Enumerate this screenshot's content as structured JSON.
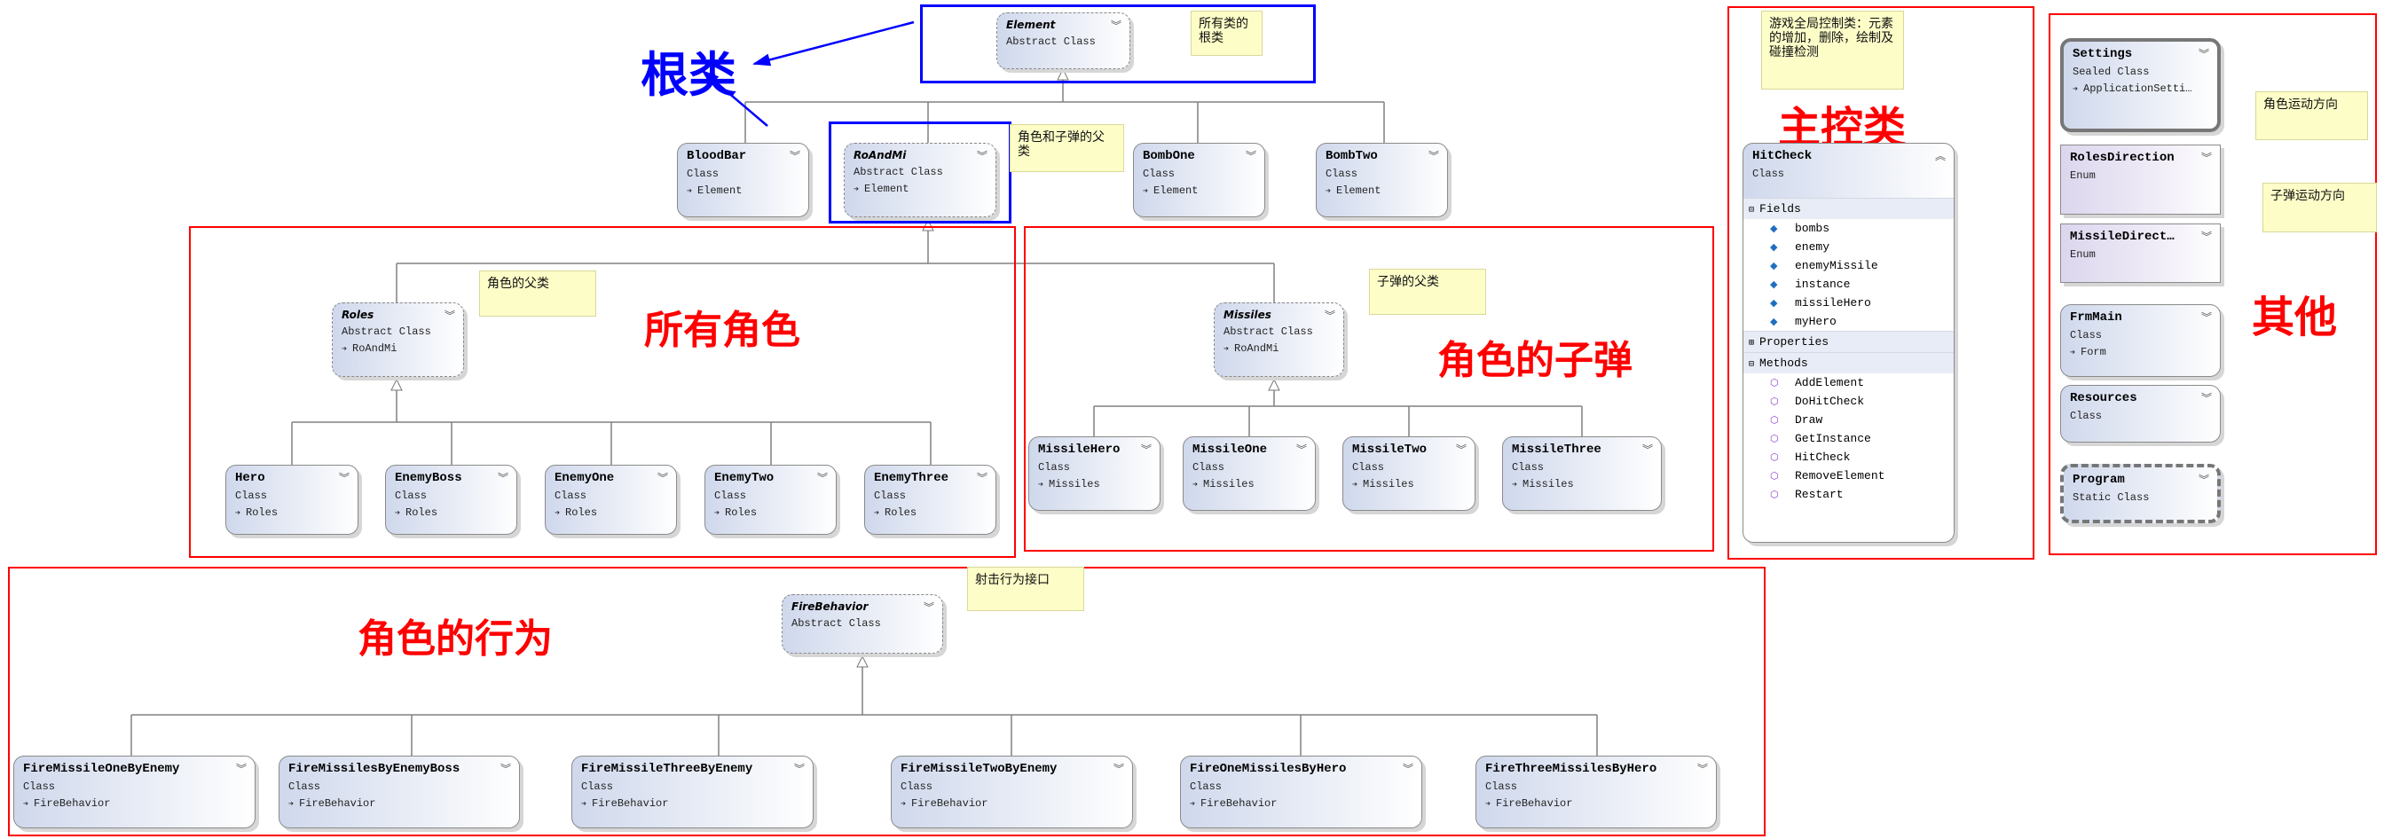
{
  "labels": {
    "root": "根类",
    "all_roles": "所有角色",
    "role_missiles": "角色的子弹",
    "role_behavior": "角色的行为",
    "main_control": "主控类",
    "others": "其他"
  },
  "colors": {
    "group_border": "#ff0000",
    "root_border": "#0000ff",
    "note_bg": "#fdfdc8"
  },
  "notes": [
    "所有类的根类",
    "角色和子弹的父类",
    "角色的父类",
    "子弹的父类",
    "射击行为接口",
    "游戏全局控制类：元素的增加，删除，绘制及碰撞检测",
    "角色运动方向",
    "子弹运动方向"
  ],
  "classes": [
    {
      "name": "Element",
      "kind": "Abstract Class",
      "base": "",
      "style": "abstract"
    },
    {
      "name": "BloodBar",
      "kind": "Class",
      "base": "Element",
      "style": ""
    },
    {
      "name": "RoAndMi",
      "kind": "Abstract Class",
      "base": "Element",
      "style": "abstract"
    },
    {
      "name": "BombOne",
      "kind": "Class",
      "base": "Element",
      "style": ""
    },
    {
      "name": "BombTwo",
      "kind": "Class",
      "base": "Element",
      "style": ""
    },
    {
      "name": "Roles",
      "kind": "Abstract Class",
      "base": "RoAndMi",
      "style": "abstract"
    },
    {
      "name": "Hero",
      "kind": "Class",
      "base": "Roles",
      "style": ""
    },
    {
      "name": "EnemyBoss",
      "kind": "Class",
      "base": "Roles",
      "style": ""
    },
    {
      "name": "EnemyOne",
      "kind": "Class",
      "base": "Roles",
      "style": ""
    },
    {
      "name": "EnemyTwo",
      "kind": "Class",
      "base": "Roles",
      "style": ""
    },
    {
      "name": "EnemyThree",
      "kind": "Class",
      "base": "Roles",
      "style": ""
    },
    {
      "name": "Missiles",
      "kind": "Abstract Class",
      "base": "RoAndMi",
      "style": "abstract"
    },
    {
      "name": "MissileHero",
      "kind": "Class",
      "base": "Missiles",
      "style": ""
    },
    {
      "name": "MissileOne",
      "kind": "Class",
      "base": "Missiles",
      "style": ""
    },
    {
      "name": "MissileTwo",
      "kind": "Class",
      "base": "Missiles",
      "style": ""
    },
    {
      "name": "MissileThree",
      "kind": "Class",
      "base": "Missiles",
      "style": ""
    },
    {
      "name": "FireBehavior",
      "kind": "Abstract Class",
      "base": "",
      "style": "abstract"
    },
    {
      "name": "FireMissileOneByEnemy",
      "kind": "Class",
      "base": "FireBehavior",
      "style": ""
    },
    {
      "name": "FireMissilesByEnemyBoss",
      "kind": "Class",
      "base": "FireBehavior",
      "style": ""
    },
    {
      "name": "FireMissileThreeByEnemy",
      "kind": "Class",
      "base": "FireBehavior",
      "style": ""
    },
    {
      "name": "FireMissileTwoByEnemy",
      "kind": "Class",
      "base": "FireBehavior",
      "style": ""
    },
    {
      "name": "FireOneMissilesByHero",
      "kind": "Class",
      "base": "FireBehavior",
      "style": ""
    },
    {
      "name": "FireThreeMissilesByHero",
      "kind": "Class",
      "base": "FireBehavior",
      "style": ""
    },
    {
      "name": "Settings",
      "kind": "Sealed Class",
      "base": "ApplicationSetti…",
      "style": "sealed"
    },
    {
      "name": "RolesDirection",
      "kind": "Enum",
      "base": "",
      "style": "enum"
    },
    {
      "name": "MissileDirect…",
      "kind": "Enum",
      "base": "",
      "style": "enum"
    },
    {
      "name": "FrmMain",
      "kind": "Class",
      "base": "Form",
      "style": ""
    },
    {
      "name": "Resources",
      "kind": "Class",
      "base": "",
      "style": ""
    },
    {
      "name": "Program",
      "kind": "Static Class",
      "base": "",
      "style": "static"
    }
  ],
  "hitcheck": {
    "name": "HitCheck",
    "kind": "Class",
    "fields_label": "Fields",
    "fields": [
      "bombs",
      "enemy",
      "enemyMissile",
      "instance",
      "missileHero",
      "myHero"
    ],
    "properties_label": "Properties",
    "methods_label": "Methods",
    "methods": [
      "AddElement",
      "DoHitCheck",
      "Draw",
      "GetInstance",
      "HitCheck",
      "RemoveElement",
      "Restart"
    ]
  }
}
